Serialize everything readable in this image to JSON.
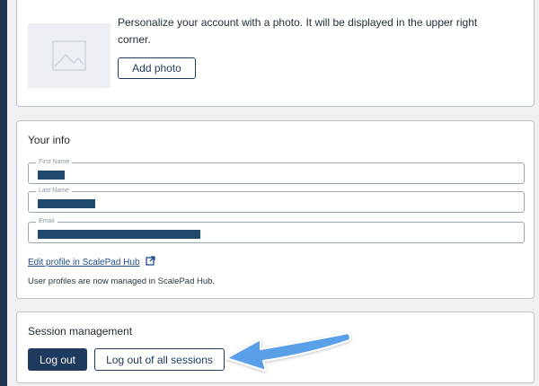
{
  "photo": {
    "description": "Personalize your account with a photo. It will be displayed in the upper right corner.",
    "add_button": "Add photo",
    "icon": "image-placeholder-icon"
  },
  "info": {
    "title": "Your info",
    "fields": [
      {
        "label": "First Name",
        "value_redacted": true
      },
      {
        "label": "Last Name",
        "value_redacted": true
      },
      {
        "label": "Email",
        "value_redacted": true
      }
    ],
    "edit_link": "Edit profile in ScalePad Hub",
    "edit_link_icon": "external-link-icon",
    "note": "User profiles are now managed in ScalePad Hub."
  },
  "session": {
    "title": "Session management",
    "logout_button": "Log out",
    "logout_all_button": "Log out of all sessions"
  },
  "annotation": {
    "icon": "arrow-pointer-icon",
    "color": "#5aa0e8"
  },
  "colors": {
    "primary": "#1e3a5f",
    "redaction": "#1f4a6e",
    "link": "#1f4f8a"
  }
}
